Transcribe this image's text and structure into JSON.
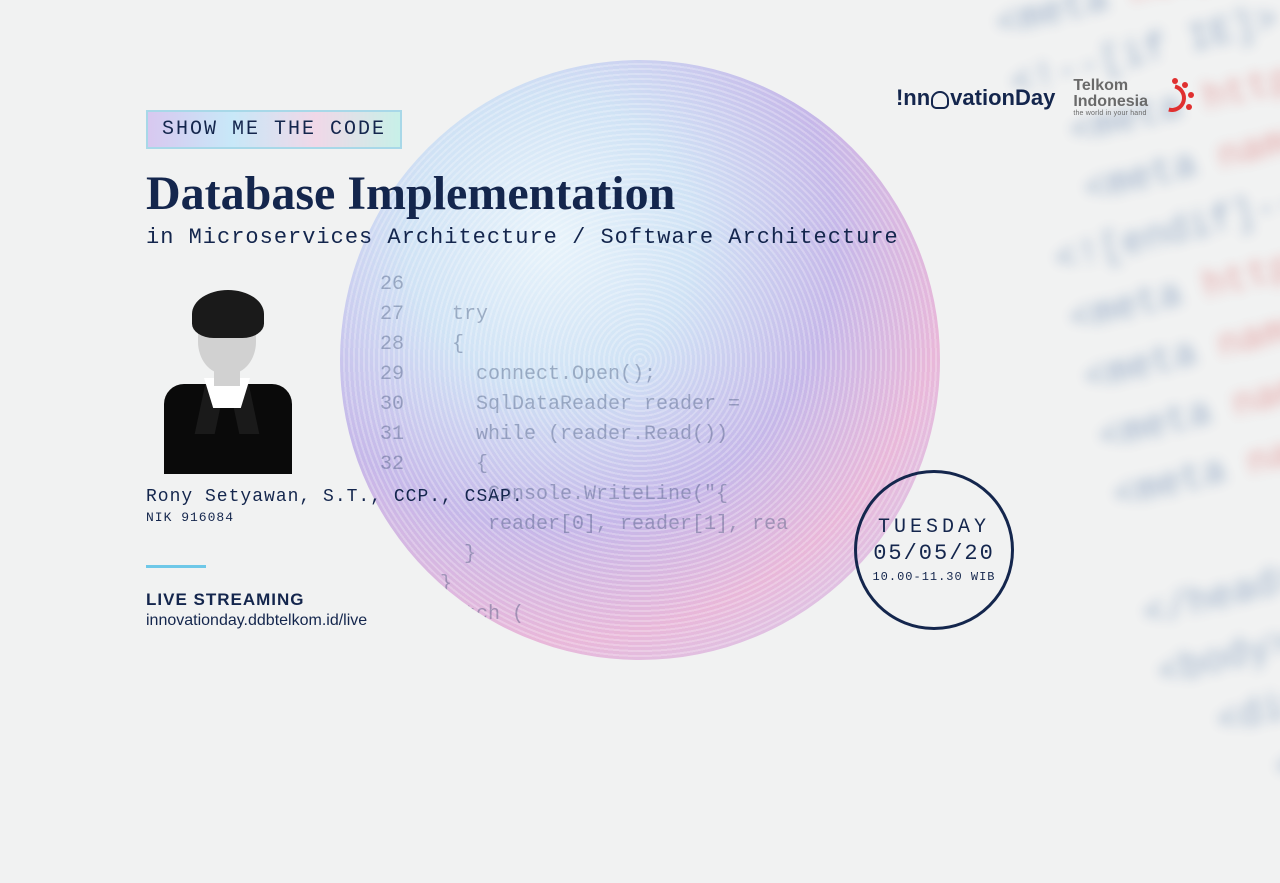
{
  "event_tag": "SHOW ME THE CODE",
  "title": "Database Implementation",
  "subtitle": "in Microservices Architecture / Software Architecture",
  "speaker": {
    "name": "Rony Setyawan, S.T., CCP., CSAP.",
    "nik": "NIK 916084"
  },
  "live": {
    "label": "LIVE STREAMING",
    "url": "innovationday.ddbtelkom.id/live"
  },
  "schedule": {
    "day": "TUESDAY",
    "date": "05/05/20",
    "time": "10.00-11.30 WIB"
  },
  "logos": {
    "innovation_day_prefix": "!nn",
    "innovation_day_suffix": "vationDay",
    "telkom_line1": "Telkom",
    "telkom_line2": "Indonesia",
    "telkom_tagline": "the world in your hand"
  }
}
